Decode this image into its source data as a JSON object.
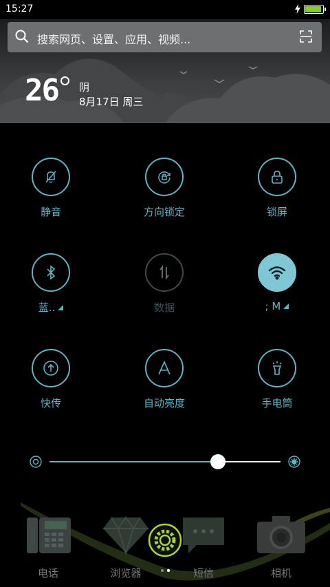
{
  "status_bar": {
    "time": "15:27",
    "battery_level": 0.95
  },
  "search": {
    "placeholder": "搜索网页、设置、应用、视频..."
  },
  "weather": {
    "temperature": "26",
    "condition": "阴",
    "date": "8月17日 周三"
  },
  "toggles": [
    {
      "label": "静音",
      "icon": "bell-off-icon",
      "state": "off"
    },
    {
      "label": "方向锁定",
      "icon": "rotation-lock-icon",
      "state": "off"
    },
    {
      "label": "锁屏",
      "icon": "lock-icon",
      "state": "off"
    },
    {
      "label": "蓝..",
      "icon": "bluetooth-icon",
      "state": "off"
    },
    {
      "label": "数据",
      "icon": "mobile-data-icon",
      "state": "disabled"
    },
    {
      "label": "; M",
      "icon": "wifi-icon",
      "state": "on"
    },
    {
      "label": "快传",
      "icon": "share-icon",
      "state": "off"
    },
    {
      "label": "自动亮度",
      "icon": "auto-brightness-icon",
      "state": "off"
    },
    {
      "label": "手电筒",
      "icon": "flashlight-icon",
      "state": "off"
    }
  ],
  "brightness": {
    "level": 0.73
  },
  "dock": [
    {
      "label": "电话",
      "icon": "phone-icon"
    },
    {
      "label": "浏览器",
      "icon": "browser-icon"
    },
    {
      "label": "短信",
      "icon": "messages-icon"
    },
    {
      "label": "相机",
      "icon": "camera-icon"
    }
  ],
  "colors": {
    "accent": "#5fb3c5",
    "active_fill": "#7ec8d6",
    "battery": "#7ed321"
  }
}
